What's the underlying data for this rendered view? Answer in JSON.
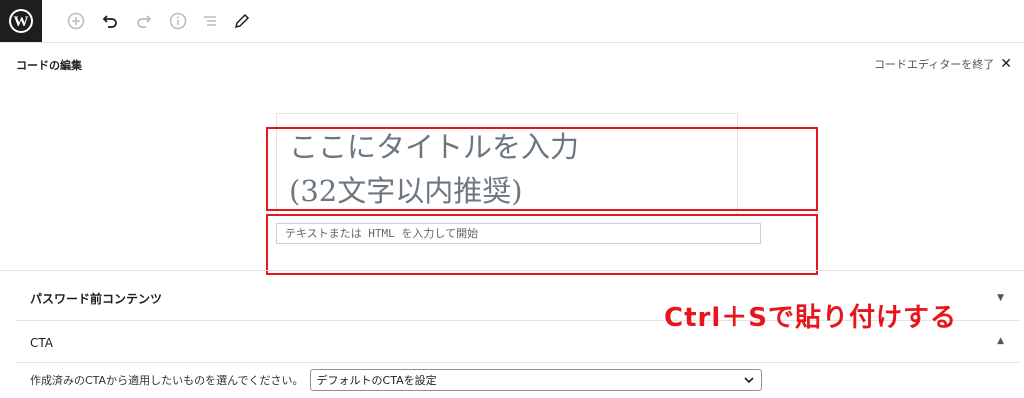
{
  "toolbar": {
    "logo_icon": "wordpress-logo-icon",
    "icons": [
      "add-block-icon",
      "undo-icon",
      "redo-icon",
      "info-icon",
      "list-view-icon",
      "edit-pencil-icon"
    ]
  },
  "editor": {
    "mode_title": "コードの編集",
    "exit_label": "コードエディターを終了",
    "exit_icon": "close-icon",
    "title_line1": "ここにタイトルを入力",
    "title_line2": "(32文字以内推奨)",
    "content_placeholder": "テキストまたは HTML を入力して開始"
  },
  "panels": {
    "password": {
      "label": "パスワード前コンテンツ",
      "expanded": false
    },
    "cta": {
      "label": "CTA",
      "expanded": true,
      "select_label": "作成済みのCTAから適用したいものを選んでください。",
      "selected_value": "デフォルトのCTAを設定"
    }
  },
  "annotation": {
    "text": "Ctrl＋Sで貼り付けする",
    "color": "#e8161b"
  },
  "colors": {
    "highlight": "#e8161b",
    "logo_bg": "#1e1e1e"
  }
}
